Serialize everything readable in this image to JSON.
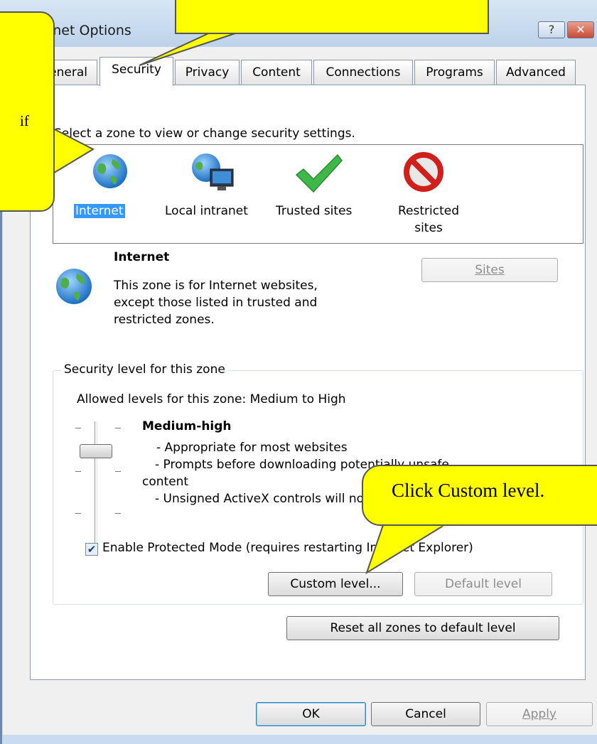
{
  "window": {
    "title": "Internet Options",
    "help_glyph": "?",
    "close_glyph": "✕"
  },
  "tabs": [
    {
      "label": "General"
    },
    {
      "label": "Security"
    },
    {
      "label": "Privacy"
    },
    {
      "label": "Content"
    },
    {
      "label": "Connections"
    },
    {
      "label": "Programs"
    },
    {
      "label": "Advanced"
    }
  ],
  "zone_prompt": "Select a zone to view or change security settings.",
  "zones": [
    {
      "label": "Internet",
      "icon": "globe-icon"
    },
    {
      "label": "Local intranet",
      "icon": "intranet-icon"
    },
    {
      "label": "Trusted sites",
      "icon": "checkmark-icon"
    },
    {
      "label": "Restricted sites",
      "icon": "prohibited-icon"
    }
  ],
  "zone_info": {
    "name": "Internet",
    "description_line1": "This zone is for Internet websites,",
    "description_line2": "except those listed in trusted and",
    "description_line3": "restricted zones.",
    "sites_button": "Sites"
  },
  "security_level": {
    "group_title": "Security level for this zone",
    "allowed_levels": "Allowed levels for this zone: Medium to High",
    "level_name": "Medium-high",
    "bullets": [
      "- Appropriate for most websites",
      "- Prompts before downloading potentially unsafe",
      "content",
      "- Unsigned ActiveX controls will not be downloaded"
    ],
    "protected_mode_label": "Enable Protected Mode (requires restarting Internet Explorer)",
    "protected_mode_checked": true,
    "custom_level_button": "Custom level...",
    "default_level_button": "Default level",
    "reset_all_button": "Reset all zones to default level"
  },
  "footer": {
    "ok": "OK",
    "cancel": "Cancel",
    "apply": "Apply"
  },
  "callouts": {
    "left_partial": "if",
    "custom_level": "Click Custom level."
  },
  "colors": {
    "callout_fill": "#ffff00",
    "selection": "#3399ff",
    "titlebar": "#c9dbee"
  }
}
